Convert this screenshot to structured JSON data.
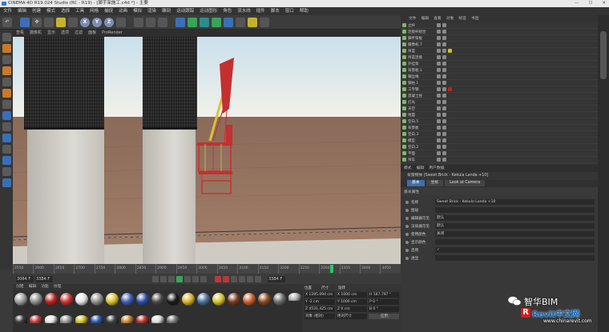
{
  "window": {
    "title": "CINEMA 4D R19.024 Studio (RC - R19) - [脚手架施工.c4d *] - 主要",
    "controls": [
      "—",
      "☐",
      "✕"
    ]
  },
  "menu": [
    "文件",
    "编辑",
    "创建",
    "模式",
    "选择",
    "工具",
    "网格",
    "捕捉",
    "动画",
    "模拟",
    "渲染",
    "雕刻",
    "运动跟踪",
    "运动图形",
    "角色",
    "流水线",
    "插件",
    "脚本",
    "窗口",
    "帮助"
  ],
  "toolbar": {
    "axis_buttons": [
      "X",
      "Y",
      "Z"
    ]
  },
  "viewport": {
    "menu": [
      "查看",
      "摄像机",
      "显示",
      "选项",
      "过滤",
      "面板",
      "ProRender"
    ]
  },
  "timeline": {
    "ticks": [
      "2550",
      "2600",
      "2650",
      "2700",
      "2750",
      "2800",
      "2850",
      "2900",
      "2950",
      "3000",
      "3050",
      "3100",
      "3150",
      "3200",
      "3250",
      "3300",
      "3350",
      "3400",
      "3450"
    ],
    "current_frame": "3384 F",
    "end_frame": "3384 F",
    "start_field": "3084 F",
    "end_field": "3384 F"
  },
  "materials": {
    "menu": [
      "创建",
      "编辑",
      "功能",
      "纹理"
    ],
    "swatches": [
      "#9c9c9c",
      "#8a8a8a",
      "#c22020",
      "#d03030",
      "#e3e3e3",
      "#8e8e8e",
      "#d9c12a",
      "#3f5bb8",
      "#2c4fa8",
      "#4a4a4a",
      "#1a1a1a",
      "#d8b423",
      "#4f6f9e",
      "#d4c32a",
      "#7a3a1e",
      "#c9602a",
      "#8a4a20",
      "#6a6a6a",
      "#b5b5b5",
      "#3d3d3d",
      "#c04040",
      "#e6e6e6",
      "#999999",
      "#d0c030",
      "#2e58b0",
      "#444444",
      "#cc8833",
      "#bb3333",
      "#dddddd",
      "#777777"
    ]
  },
  "coords": {
    "headers": [
      "位置",
      "尺寸",
      "旋转"
    ],
    "rows": [
      [
        "X 1285.094 cm",
        "X 1000 cm",
        "H 167.797 °"
      ],
      [
        "Y -2 cm",
        "Y 1000 cm",
        "P 0 °"
      ],
      [
        "Z 4531.425 cm",
        "Z 0 cm",
        "B 0 °"
      ]
    ],
    "mode": "对象 (相对)",
    "size_mode": "绝对尺寸",
    "apply": "应用"
  },
  "objects": {
    "menu": [
      "文件",
      "编辑",
      "查看",
      "对象",
      "标签",
      "书签"
    ],
    "items": [
      {
        "name": "立杆",
        "selected": false,
        "tag": ""
      },
      {
        "name": "连接杆组合",
        "selected": false,
        "tag": ""
      },
      {
        "name": "脚手架板",
        "selected": false,
        "tag": ""
      },
      {
        "name": "摄像机.7",
        "selected": false,
        "tag": ""
      },
      {
        "name": "吊篮",
        "selected": false,
        "tag": "#d0c030"
      },
      {
        "name": "吊篮连接",
        "selected": false,
        "tag": ""
      },
      {
        "name": "外挂架",
        "selected": false,
        "tag": ""
      },
      {
        "name": "背景板.1",
        "selected": false,
        "tag": ""
      },
      {
        "name": "钢丝绳",
        "selected": false,
        "tag": ""
      },
      {
        "name": "钢柱.1",
        "selected": false,
        "tag": ""
      },
      {
        "name": "工字钢",
        "selected": false,
        "tag": "#c02020"
      },
      {
        "name": "混凝土柱",
        "selected": false,
        "tag": ""
      },
      {
        "name": "灯光",
        "selected": false,
        "tag": ""
      },
      {
        "name": "天空",
        "selected": false,
        "tag": ""
      },
      {
        "name": "地面",
        "selected": false,
        "tag": ""
      },
      {
        "name": "空白.5",
        "selected": false,
        "tag": ""
      },
      {
        "name": "背景板",
        "selected": false,
        "tag": ""
      },
      {
        "name": "空白.3",
        "selected": false,
        "tag": ""
      },
      {
        "name": "模型",
        "selected": false,
        "tag": ""
      },
      {
        "name": "空白.2",
        "selected": false,
        "tag": ""
      },
      {
        "name": "平面",
        "selected": false,
        "tag": ""
      },
      {
        "name": "吊车",
        "selected": false,
        "tag": ""
      }
    ]
  },
  "attributes": {
    "menu": [
      "模式",
      "编辑",
      "用户数据"
    ],
    "object_label": "背景物体 [Sweet Brick - Kekula Landa +10]",
    "tabs": [
      "基本",
      "坐标",
      "Look at Camera"
    ],
    "section": "基本属性",
    "fields": [
      {
        "label": "名称",
        "value": "Sweet Brick - Kekula Landa +10"
      },
      {
        "label": "图层",
        "value": ""
      },
      {
        "label": "编辑器可见",
        "value": "默认"
      },
      {
        "label": "渲染器可见",
        "value": "默认"
      },
      {
        "label": "使用颜色",
        "value": "关闭"
      },
      {
        "label": "显示颜色",
        "value": ""
      },
      {
        "label": "启用",
        "value": "✓"
      },
      {
        "label": "透显",
        "value": ""
      }
    ]
  },
  "watermark": {
    "brand": "智华BIM",
    "revit_cn": "Revit中文网",
    "url": "www.chinarevit.com"
  }
}
